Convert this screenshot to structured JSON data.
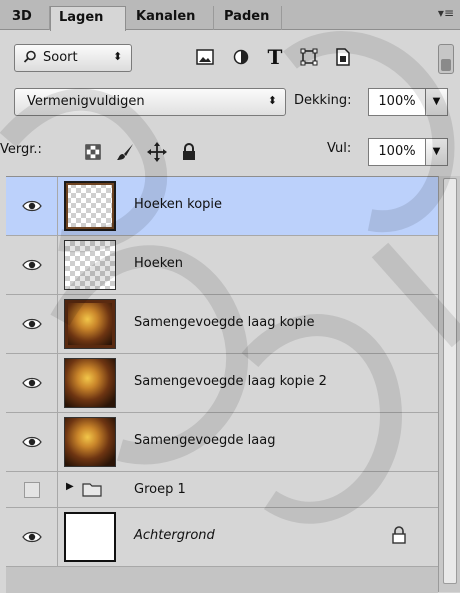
{
  "tabs": [
    {
      "label": "3D"
    },
    {
      "label": "Lagen",
      "active": true
    },
    {
      "label": "Kanalen"
    },
    {
      "label": "Paden"
    }
  ],
  "filter": {
    "kind_label": "Soort",
    "icons": [
      "image-filter-icon",
      "adjustment-filter-icon",
      "type-filter-icon",
      "shape-filter-icon",
      "smart-object-filter-icon"
    ]
  },
  "blend": {
    "mode": "Vermenigvuldigen",
    "opacity_label": "Dekking:",
    "opacity_value": "100%"
  },
  "lock": {
    "label": "Vergr.:",
    "fill_label": "Vul:",
    "fill_value": "100%",
    "icons": [
      "lock-transparent-icon",
      "lock-pixels-icon",
      "lock-position-icon",
      "lock-all-icon"
    ]
  },
  "layers": [
    {
      "name": "Hoeken kopie",
      "thumb": "transparent-frame",
      "visible": true,
      "selected": true
    },
    {
      "name": "Hoeken",
      "thumb": "transparent",
      "visible": true
    },
    {
      "name": "Samengevoegde laag kopie",
      "thumb": "photo-framed",
      "visible": true
    },
    {
      "name": "Samengevoegde laag kopie 2",
      "thumb": "photo",
      "visible": true
    },
    {
      "name": "Samengevoegde laag",
      "thumb": "photo",
      "visible": true
    },
    {
      "name": "Groep 1",
      "type": "group",
      "visible": false
    },
    {
      "name": "Achtergrond",
      "thumb": "white",
      "visible": true,
      "locked": true,
      "italic": true
    }
  ],
  "colors": {
    "selected_row": "#bcd1fb",
    "panel_bg": "#d6d6d6",
    "tab_bar": "#b9b9b9"
  }
}
